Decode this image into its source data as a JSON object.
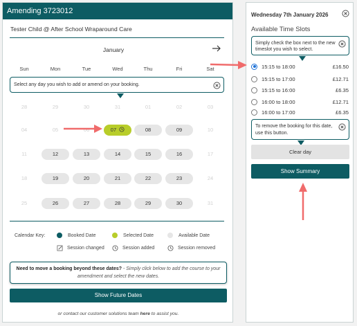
{
  "left": {
    "header_title": "Amending 3723012",
    "child_line": "Tester Child @ After School Wraparound Care",
    "month": "January",
    "weekdays": [
      "Sun",
      "Mon",
      "Tue",
      "Wed",
      "Thu",
      "Fri",
      "Sat"
    ],
    "tip_select_day": "Select any day you wish to add or amend on your booking.",
    "weeks": [
      [
        "28",
        "29",
        "30",
        "31",
        "01",
        "02",
        "03"
      ],
      [
        "04",
        "05",
        "06",
        "07",
        "08",
        "09",
        "10"
      ],
      [
        "11",
        "12",
        "13",
        "14",
        "15",
        "16",
        "17"
      ],
      [
        "18",
        "19",
        "20",
        "21",
        "22",
        "23",
        "24"
      ],
      [
        "25",
        "26",
        "27",
        "28",
        "29",
        "30",
        "31"
      ]
    ],
    "key": {
      "label": "Calendar Key:",
      "booked": "Booked Date",
      "selected": "Selected Date",
      "available": "Available Date",
      "changed": "Session changed",
      "added": "Session added",
      "removed": "Session removed"
    },
    "move_box": {
      "bold": "Need to move a booking beyond these dates?",
      "italic": " - Simply click below to add the course to your amendment and select the new dates."
    },
    "future_button": "Show Future Dates",
    "contact": {
      "prefix": "or contact our customer solutions team ",
      "link": "here",
      "suffix": " to assist you."
    }
  },
  "right": {
    "date": "Wednesday 7th January 2026",
    "title": "Available Time Slots",
    "tip_check": "Simply check the box next to the new timeslot you wish to select.",
    "slots": [
      {
        "time": "15:15 to 18:00",
        "price": "£16.50",
        "checked": true
      },
      {
        "time": "15:15 to 17:00",
        "price": "£12.71",
        "checked": false
      },
      {
        "time": "15:15 to 16:00",
        "price": "£6.35",
        "checked": false
      },
      {
        "time": "16:00 to 18:00",
        "price": "£12.71",
        "checked": false
      },
      {
        "time": "16:00 to 17:00",
        "price": "£6.35",
        "checked": false
      }
    ],
    "tip_remove": "To remove the booking for this date, use this button.",
    "clear_button": "Clear day",
    "summary_button": "Show Summary"
  },
  "colors": {
    "brand": "#0d5c63",
    "selected": "#b8cd2a",
    "available": "#e6e6e6",
    "arrow": "#f06b6b",
    "radio": "#1a6fd6"
  },
  "icons": {
    "next": "arrow-right-icon",
    "close": "close-circle-icon",
    "changed": "pencil-icon",
    "added": "clock-icon",
    "removed": "clock-icon"
  }
}
